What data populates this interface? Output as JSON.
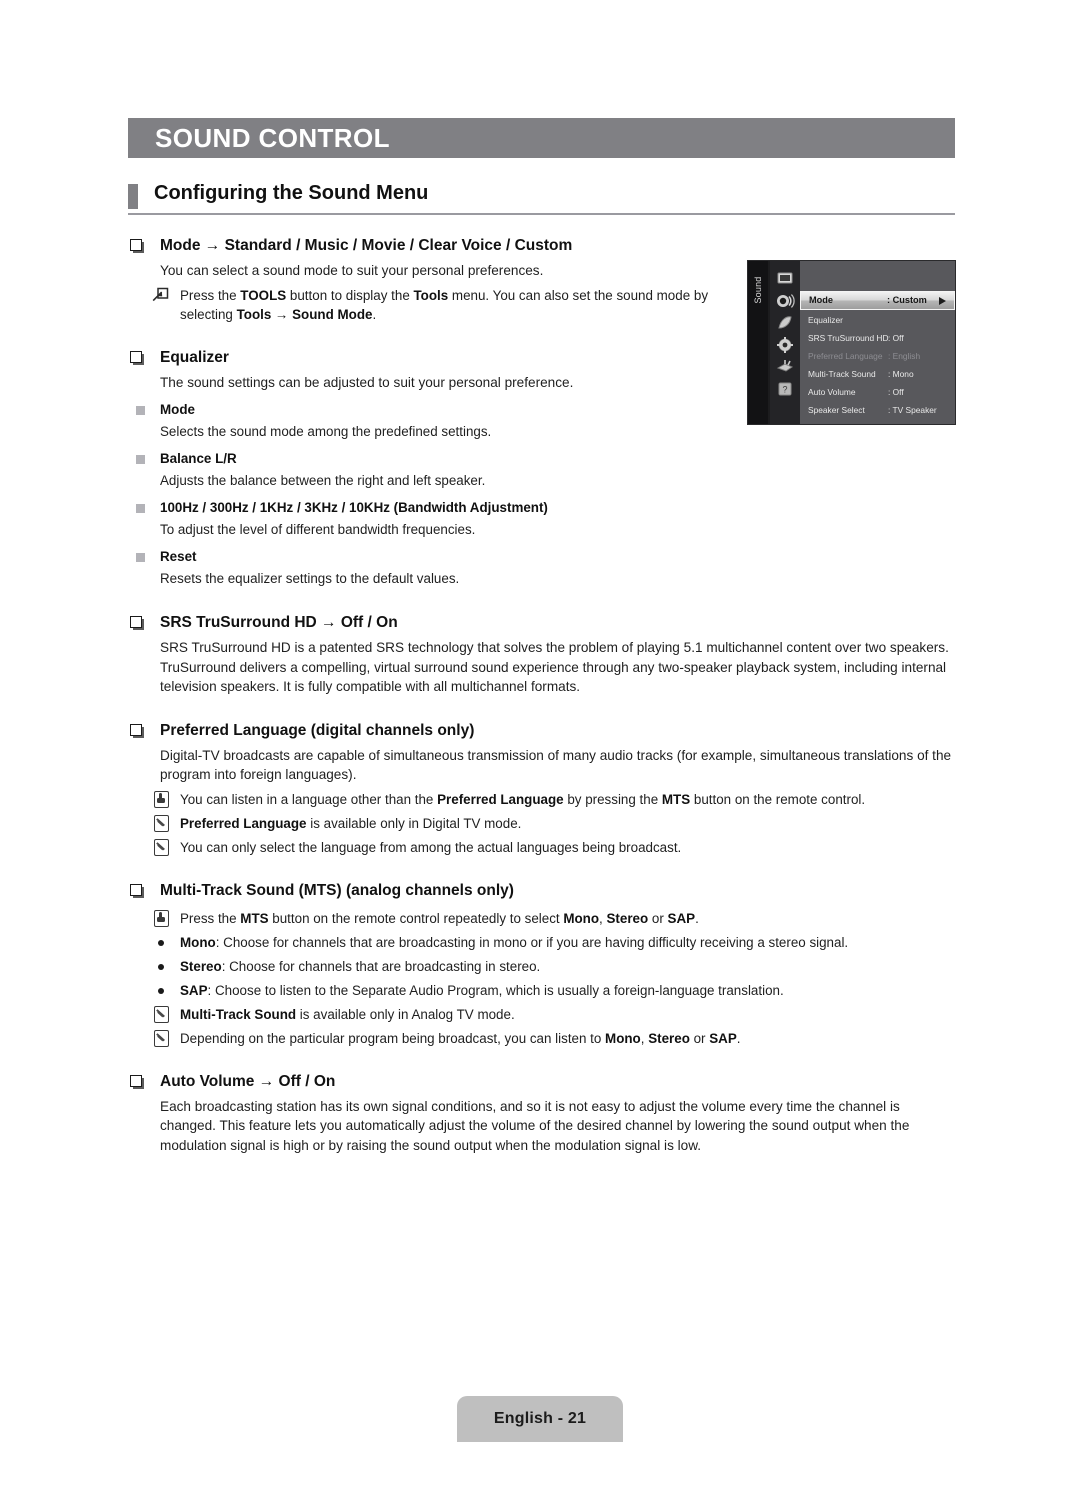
{
  "chapter": {
    "title": "SOUND CONTROL"
  },
  "section": {
    "title": "Configuring the Sound Menu"
  },
  "topics": {
    "mode": {
      "title": "Mode → Standard / Music / Movie / Clear Voice / Custom",
      "para": "You can select a sound mode to suit your personal preferences.",
      "tools_note_html": "Press the <b>TOOLS</b> button to display the <b>Tools</b> menu. You can also set the sound mode by selecting <b>Tools → Sound Mode</b>."
    },
    "equalizer": {
      "title": "Equalizer",
      "para": "The sound settings can be adjusted to suit your personal preference.",
      "subitems": [
        {
          "title": "Mode",
          "desc": "Selects the sound mode among the predefined settings."
        },
        {
          "title": "Balance L/R",
          "desc": "Adjusts the balance between the right and left speaker."
        },
        {
          "title": "100Hz / 300Hz / 1KHz / 3KHz / 10KHz (Bandwidth Adjustment)",
          "desc": "To adjust the level of different bandwidth frequencies."
        },
        {
          "title": "Reset",
          "desc": "Resets the equalizer settings to the default values."
        }
      ]
    },
    "srs": {
      "title": "SRS TruSurround HD → Off / On",
      "para": "SRS TruSurround HD is a patented SRS technology that solves the problem of playing 5.1 multichannel content over two speakers. TruSurround delivers a compelling, virtual surround sound experience through any two-speaker playback system, including internal television speakers. It is fully compatible with all multichannel formats."
    },
    "preferred_language": {
      "title": "Preferred Language (digital channels only)",
      "para": "Digital-TV broadcasts are capable of simultaneous transmission of many audio tracks (for example, simultaneous translations of the program into foreign languages).",
      "notes": [
        {
          "icon": "hand-press-icon",
          "html": "You can listen in a language other than the <b>Preferred Language</b> by pressing the <b>MTS</b> button on the remote control."
        },
        {
          "icon": "note-pencil-icon",
          "html": "<b>Preferred Language</b> is available only in Digital TV mode."
        },
        {
          "icon": "note-pencil-icon",
          "html": "You can only select the language from among the actual languages being broadcast."
        }
      ]
    },
    "mts": {
      "title": "Multi-Track Sound (MTS) (analog channels only)",
      "notes_top": [
        {
          "icon": "hand-press-icon",
          "html": "Press the <b>MTS</b> button on the remote control repeatedly to select <b>Mono</b>, <b>Stereo</b> or <b>SAP</b>."
        }
      ],
      "dots": [
        {
          "html": "<b>Mono</b>: Choose for channels that are broadcasting in mono or if you are having difficulty receiving a stereo signal."
        },
        {
          "html": "<b>Stereo</b>: Choose for channels that are broadcasting in stereo."
        },
        {
          "html": "<b>SAP</b>: Choose to listen to the Separate Audio Program, which is usually a foreign-language translation."
        }
      ],
      "notes_bottom": [
        {
          "icon": "note-pencil-icon",
          "html": "<b>Multi-Track Sound</b> is available only in Analog TV mode."
        },
        {
          "icon": "note-pencil-icon",
          "html": "Depending on the particular program being broadcast, you can listen to <b>Mono</b>, <b>Stereo</b> or <b>SAP</b>."
        }
      ]
    },
    "auto_volume": {
      "title": "Auto Volume → Off / On",
      "para": "Each broadcasting station has its own signal conditions, and so it is not easy to adjust the volume every time the channel is changed. This feature lets you automatically adjust the volume of the desired channel by lowering the sound output when the modulation signal is high or by raising the sound output when the modulation signal is low."
    }
  },
  "osd": {
    "rail_label": "Sound",
    "rail_icons": [
      "picture-icon",
      "sound-speaker-icon",
      "channel-antenna-icon",
      "setup-gear-icon",
      "input-plug-icon",
      "support-question-icon"
    ],
    "rows": [
      {
        "label": "Mode",
        "value": ": Custom",
        "selected": true,
        "dimmed": false,
        "arrow": true
      },
      {
        "label": "Equalizer",
        "value": "",
        "selected": false,
        "dimmed": false,
        "arrow": false
      },
      {
        "label": "SRS TruSurround HD",
        "value": ": Off",
        "selected": false,
        "dimmed": false,
        "arrow": false
      },
      {
        "label": "Preferred Language",
        "value": ": English",
        "selected": false,
        "dimmed": true,
        "arrow": false
      },
      {
        "label": "Multi-Track Sound",
        "value": ": Mono",
        "selected": false,
        "dimmed": false,
        "arrow": false
      },
      {
        "label": "Auto Volume",
        "value": ": Off",
        "selected": false,
        "dimmed": false,
        "arrow": false
      },
      {
        "label": "Speaker Select",
        "value": ": TV Speaker",
        "selected": false,
        "dimmed": false,
        "arrow": false
      }
    ]
  },
  "footer": {
    "label": "English - 21"
  },
  "colors": {
    "banner_gray": "#808084",
    "rule_gray": "#9a9aa0",
    "bullet_gray": "#b3b3b8",
    "footer_gray": "#bfbfbf",
    "osd_body": "#58585c",
    "osd_rail": "#121214"
  }
}
